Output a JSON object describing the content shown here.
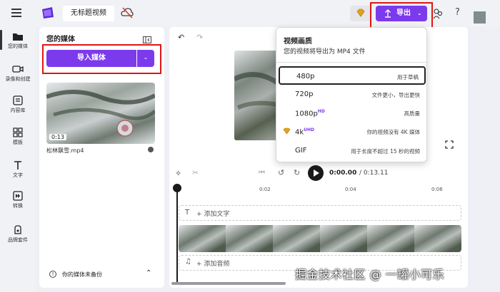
{
  "topbar": {
    "project_title": "无标题视频",
    "export_label": "导出",
    "help_label": "?"
  },
  "rail": [
    {
      "label": "您的媒体",
      "icon": "folder-icon"
    },
    {
      "label": "录像和创建",
      "icon": "video-camera-icon"
    },
    {
      "label": "内容库",
      "icon": "library-icon"
    },
    {
      "label": "模板",
      "icon": "templates-icon"
    },
    {
      "label": "文字",
      "icon": "text-icon"
    },
    {
      "label": "转换",
      "icon": "transition-icon"
    },
    {
      "label": "品牌套件",
      "icon": "brand-kit-icon"
    }
  ],
  "media_panel": {
    "title": "您的媒体",
    "import_label": "导入媒体",
    "clip_name": "松林飘雪.mp4",
    "clip_duration": "0:13",
    "backup_status": "你的媒体未备份"
  },
  "export_menu": {
    "heading": "视频画质",
    "subheading": "您的视频将导出为 MP4 文件",
    "options": [
      {
        "label": "480p",
        "badge": "",
        "desc": "用于草稿",
        "premium": false,
        "selected": true
      },
      {
        "label": "720p",
        "badge": "",
        "desc": "文件更小，导出更快",
        "premium": false,
        "selected": false
      },
      {
        "label": "1080p",
        "badge": "HD",
        "desc": "高质量",
        "premium": false,
        "selected": false
      },
      {
        "label": "4k",
        "badge": "UHD",
        "desc": "你的视频没有 4K 媒体",
        "premium": true,
        "selected": false
      },
      {
        "label": "GIF",
        "badge": "",
        "desc": "用于长度不超过 15 秒的视频",
        "premium": false,
        "selected": false
      }
    ]
  },
  "playback": {
    "current_time": "0:00.00",
    "total_time": "/ 0:13.11"
  },
  "timeline": {
    "ticks": [
      "0:02",
      "0:04",
      "0:06"
    ],
    "add_text_label": "+ 添加文字",
    "add_audio_label": "+ 添加音频"
  },
  "watermark": "掘金技术社区 @ 一罐小可乐",
  "colors": {
    "accent": "#7c3aed",
    "highlight_border": "#e01515",
    "premium_gold": "#e3a21a"
  }
}
